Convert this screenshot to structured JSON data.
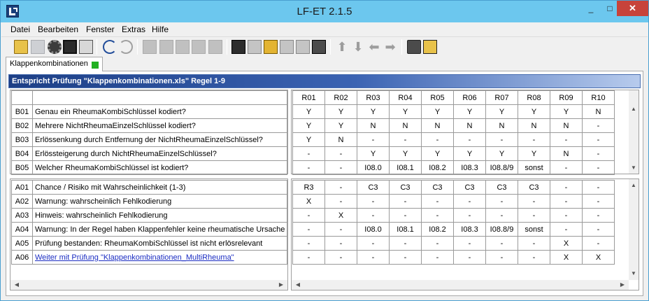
{
  "window": {
    "title": "LF-ET 2.1.5",
    "min": "_",
    "max": "□",
    "close": "✕"
  },
  "menu": [
    "Datei",
    "Bearbeiten",
    "Fenster",
    "Extras",
    "Hilfe"
  ],
  "tab": {
    "label": "Klappenkombinationen"
  },
  "header": "Entspricht Prüfung \"Klappenkombinationen.xls\" Regel 1-9",
  "rules": [
    "R01",
    "R02",
    "R03",
    "R04",
    "R05",
    "R06",
    "R07",
    "R08",
    "R09",
    "R10"
  ],
  "conditions": [
    {
      "id": "B01",
      "text": "Genau ein RheumaKombiSchlüssel kodiert?",
      "values": [
        "Y",
        "Y",
        "Y",
        "Y",
        "Y",
        "Y",
        "Y",
        "Y",
        "Y",
        "N"
      ]
    },
    {
      "id": "B02",
      "text": "Mehrere NichtRheumaEinzelSchlüssel kodiert?",
      "values": [
        "Y",
        "Y",
        "N",
        "N",
        "N",
        "N",
        "N",
        "N",
        "N",
        "-"
      ]
    },
    {
      "id": "B03",
      "text": "Erlössenkung durch Entfernung der NichtRheumaEinzelSchlüssel?",
      "values": [
        "Y",
        "N",
        "-",
        "-",
        "-",
        "-",
        "-",
        "-",
        "-",
        "-"
      ]
    },
    {
      "id": "B04",
      "text": "Erlössteigerung durch NichtRheumaEinzelSchlüssel?",
      "values": [
        "-",
        "-",
        "Y",
        "Y",
        "Y",
        "Y",
        "Y",
        "Y",
        "N",
        "-"
      ]
    },
    {
      "id": "B05",
      "text": "Welcher RheumaKombiSchlüssel ist kodiert?",
      "values": [
        "-",
        "-",
        "I08.0",
        "I08.1",
        "I08.2",
        "I08.3",
        "I08.8/9",
        "sonst",
        "-",
        "-"
      ]
    }
  ],
  "actions": [
    {
      "id": "A01",
      "text": "Chance / Risiko mit Wahrscheinlichkeit (1-3)",
      "values": [
        "R3",
        "-",
        "C3",
        "C3",
        "C3",
        "C3",
        "C3",
        "C3",
        "-",
        "-"
      ]
    },
    {
      "id": "A02",
      "text": "Warnung: wahrscheinlich Fehlkodierung",
      "values": [
        "X",
        "-",
        "-",
        "-",
        "-",
        "-",
        "-",
        "-",
        "-",
        "-"
      ]
    },
    {
      "id": "A03",
      "text": "Hinweis: wahrscheinlich Fehlkodierung",
      "values": [
        "-",
        "X",
        "-",
        "-",
        "-",
        "-",
        "-",
        "-",
        "-",
        "-"
      ]
    },
    {
      "id": "A04",
      "text": "Warnung: In der Regel haben Klappenfehler keine rheumatische Ursache",
      "values": [
        "-",
        "-",
        "I08.0",
        "I08.1",
        "I08.2",
        "I08.3",
        "I08.8/9",
        "sonst",
        "-",
        "-"
      ]
    },
    {
      "id": "A05",
      "text": "Prüfung bestanden: RheumaKombiSchlüssel ist nicht erlösrelevant",
      "values": [
        "-",
        "-",
        "-",
        "-",
        "-",
        "-",
        "-",
        "-",
        "X",
        "-"
      ]
    },
    {
      "id": "A06",
      "text": "Weiter mit Prüfung \"Klappenkombinationen_MultiRheuma\"",
      "values": [
        "-",
        "-",
        "-",
        "-",
        "-",
        "-",
        "-",
        "-",
        "X",
        "X"
      ],
      "link": true
    }
  ],
  "scroll": {
    "up": "▲",
    "down": "▼",
    "left": "◀",
    "right": "▶"
  },
  "toolbar_icons": [
    "open-folder-icon",
    "save-icon",
    "settings-gear-icon",
    "disk-icon",
    "print-icon",
    "undo-icon",
    "redo-icon",
    "cut-icon",
    "copy-icon",
    "paste-icon",
    "paste-special-icon",
    "delete-icon",
    "export-icon",
    "stamp-icon",
    "filter-icon",
    "grid-icon",
    "grid-dark-icon",
    "checklist-icon",
    "arrow-up-icon",
    "arrow-down-icon",
    "arrow-left-icon",
    "arrow-right-icon",
    "camera-icon",
    "folder-export-icon"
  ]
}
